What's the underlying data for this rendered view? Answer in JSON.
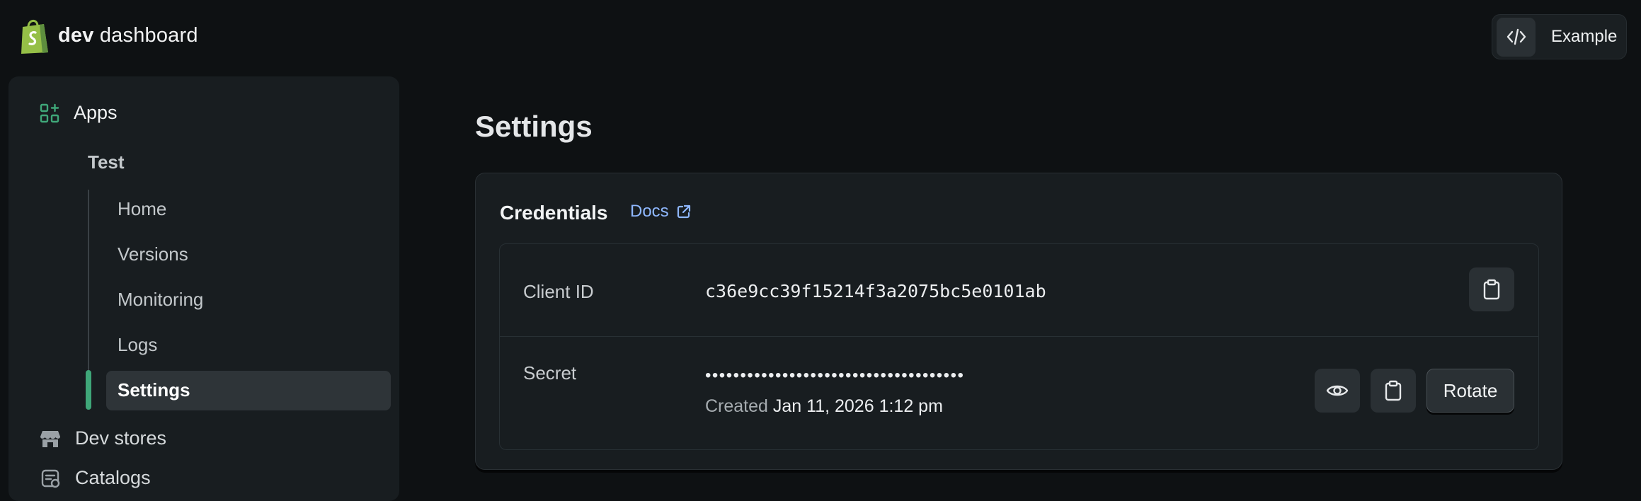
{
  "header": {
    "brand_bold": "dev",
    "brand_rest": " dashboard",
    "example_label": "Example",
    "logo_icon": "shopify-bag-icon",
    "example_icon": "code-icon"
  },
  "sidebar": {
    "apps_label": "Apps",
    "app_name": "Test",
    "sub_items": [
      "Home",
      "Versions",
      "Monitoring",
      "Logs"
    ],
    "active_item": "Settings",
    "dev_stores_label": "Dev stores",
    "catalogs_label": "Catalogs"
  },
  "main": {
    "title": "Settings",
    "credentials": {
      "title": "Credentials",
      "docs_label": "Docs",
      "client_id_label": "Client ID",
      "client_id_value": "c36e9cc39f15214f3a2075bc5e0101ab",
      "secret_label": "Secret",
      "secret_masked": "•••••••••••••••••••••••••••••••••••••",
      "created_prefix": "Created",
      "created_date": "Jan 11, 2026 1:12 pm",
      "rotate_label": "Rotate"
    }
  },
  "colors": {
    "background": "#0e1113",
    "panel": "#181d20",
    "accent_green": "#3fa779",
    "link_blue": "#8fb8ff",
    "logo_green": "#95bf47"
  }
}
